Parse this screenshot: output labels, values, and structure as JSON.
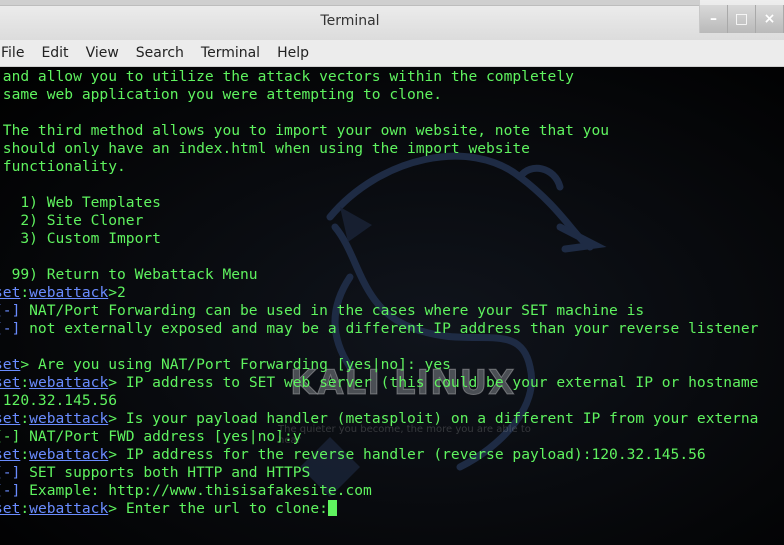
{
  "window": {
    "title": "Terminal",
    "buttons": {
      "minimize": "–",
      "maximize": "□",
      "close": "×"
    }
  },
  "menu": [
    "File",
    "Edit",
    "View",
    "Search",
    "Terminal",
    "Help"
  ],
  "terminal": {
    "lines": [
      "and allow you to utilize the attack vectors within the completely",
      "same web application you were attempting to clone.",
      "",
      "The third method allows you to import your own website, note that you",
      "should only have an index.html when using the import website",
      "functionality.",
      "",
      "  1) Web Templates",
      "  2) Site Cloner",
      "  3) Custom Import",
      "",
      " 99) Return to Webattack Menu"
    ],
    "prompt": {
      "set": "set",
      "sep": ":",
      "module": "webattack",
      "gt": ">"
    },
    "session": [
      {
        "kind": "prompt",
        "module": true,
        "text": "2"
      },
      {
        "kind": "info",
        "tag": "[-]",
        "text": " NAT/Port Forwarding can be used in the cases where your SET machine is"
      },
      {
        "kind": "info",
        "tag": "[-]",
        "text": " not externally exposed and may be a different IP address than your reverse listener"
      },
      {
        "kind": "blank"
      },
      {
        "kind": "prompt",
        "module": false,
        "text": " Are you using NAT/Port Forwarding [yes|no]: yes"
      },
      {
        "kind": "prompt",
        "module": true,
        "text": " IP address to SET web server (this could be your external IP or hostname"
      },
      {
        "kind": "plain",
        "text": ":120.32.145.56"
      },
      {
        "kind": "prompt",
        "module": true,
        "text": " Is your payload handler (metasploit) on a different IP from your externa"
      },
      {
        "kind": "plain",
        "text": "[-] NAT/Port FWD address [yes|no]:y"
      },
      {
        "kind": "prompt",
        "module": true,
        "text": " IP address for the reverse handler (reverse payload):120.32.145.56"
      },
      {
        "kind": "info",
        "tag": "[-]",
        "text": " SET supports both HTTP and HTTPS"
      },
      {
        "kind": "info",
        "tag": "[-]",
        "text": " Example: http://www.thisisafakesite.com"
      },
      {
        "kind": "prompt",
        "module": true,
        "text": " Enter the url to clone:",
        "cursor": true
      }
    ]
  },
  "watermark": {
    "logo": "KALI LINUX",
    "tagline": "The quieter you become, the more you are able to hear"
  },
  "colors": {
    "terminal_text": "#5ff35f",
    "prompt_blue": "#6a8cff",
    "background": "#000000"
  }
}
